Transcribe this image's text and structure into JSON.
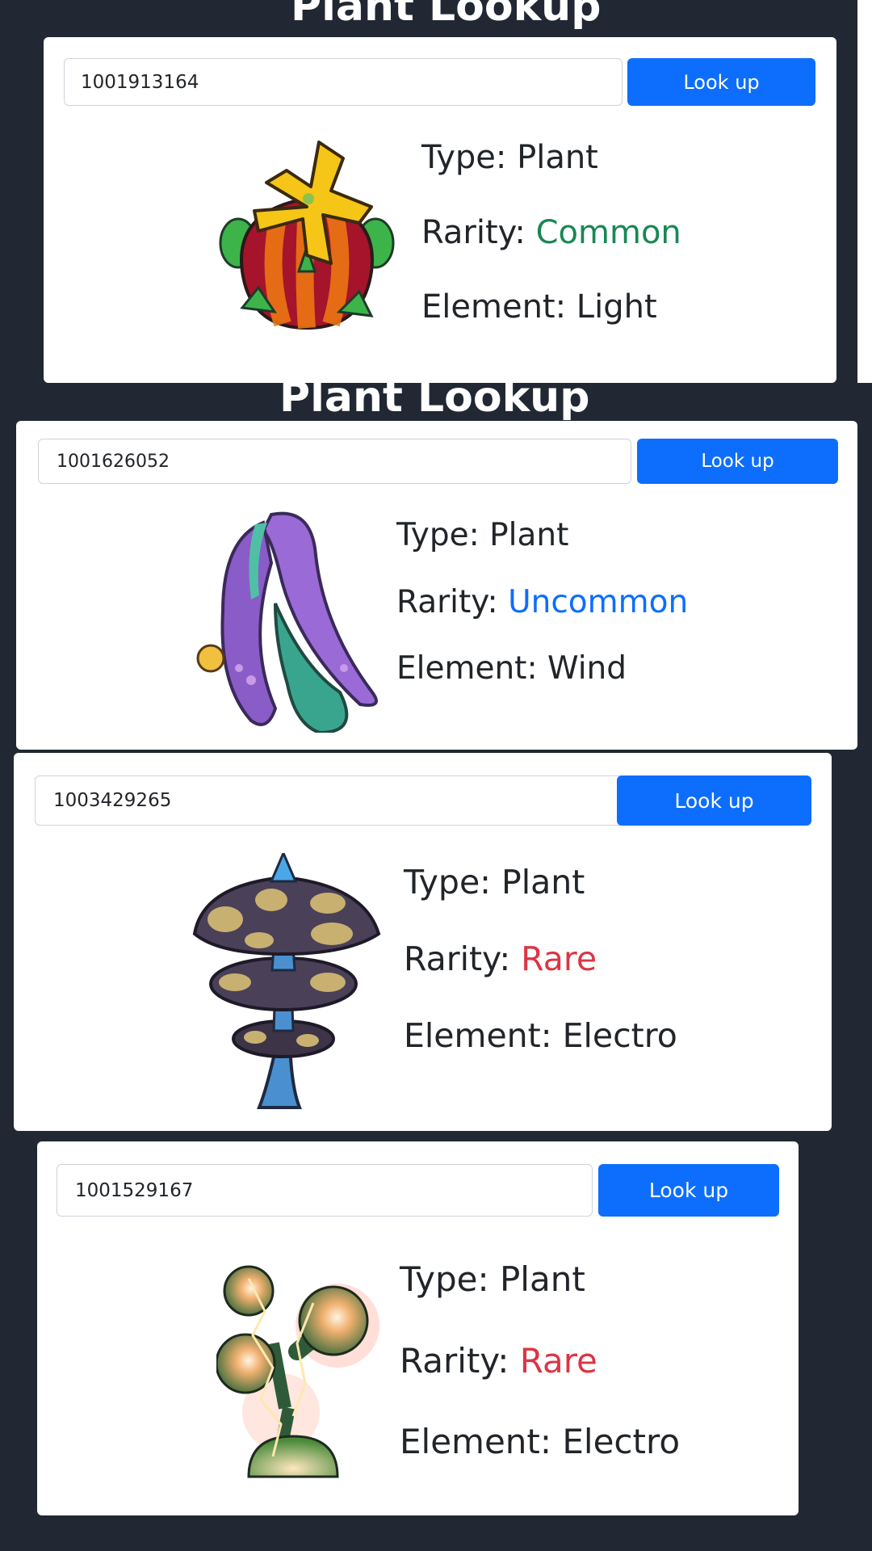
{
  "page_title": "Plant Lookup",
  "labels": {
    "type": "Type: ",
    "rarity": "Rarity: ",
    "element": "Element: "
  },
  "colors": {
    "common": "#198754",
    "uncommon": "#0d6efd",
    "rare": "#dc3545",
    "button": "#0d6efd",
    "background": "#212833"
  },
  "cards": [
    {
      "input_value": "1001913164",
      "button_label": "Look up",
      "type": "Plant",
      "rarity": "Common",
      "element": "Light",
      "image_icon": "flower-bulb-plant-icon"
    },
    {
      "input_value": "1001626052",
      "button_label": "Look up",
      "type": "Plant",
      "rarity": "Uncommon",
      "element": "Wind",
      "image_icon": "curled-leaf-plant-icon"
    },
    {
      "input_value": "1003429265",
      "button_label": "Look up",
      "type": "Plant",
      "rarity": "Rare",
      "element": "Electro",
      "image_icon": "stacked-mushroom-plant-icon"
    },
    {
      "input_value": "1001529167",
      "button_label": "Look up",
      "type": "Plant",
      "rarity": "Rare",
      "element": "Electro",
      "image_icon": "glowing-orb-plant-icon"
    }
  ]
}
